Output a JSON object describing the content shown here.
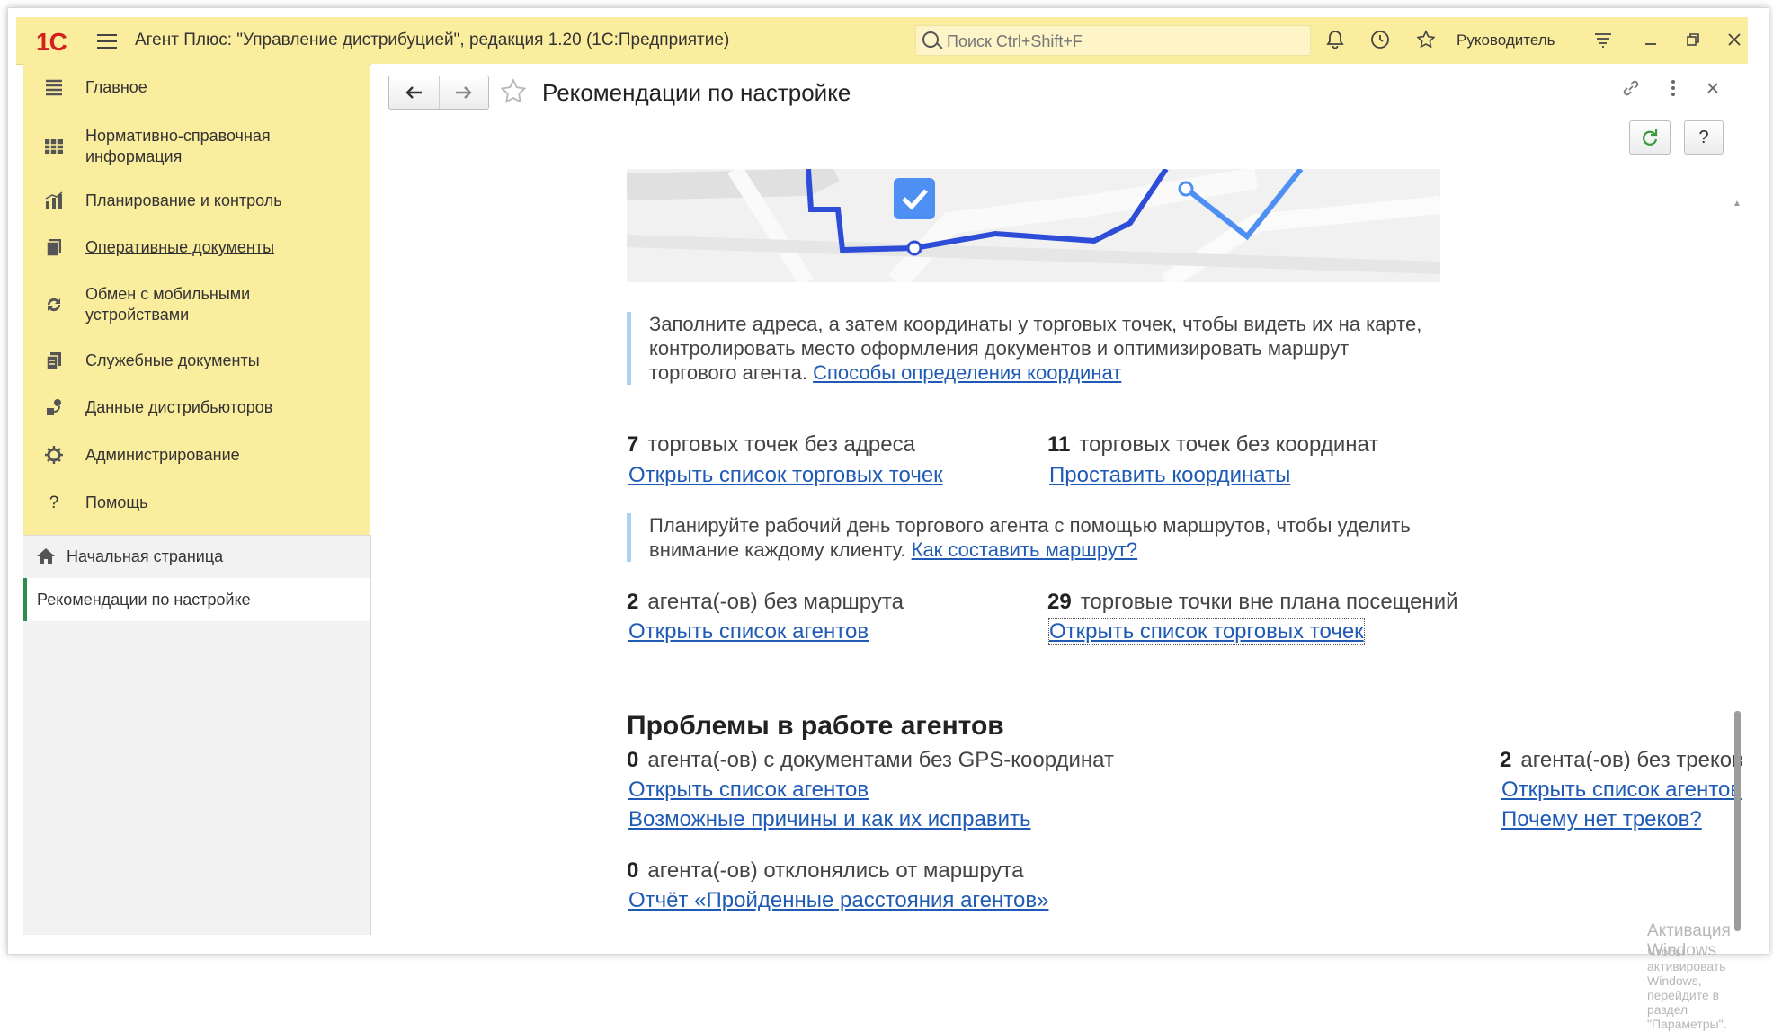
{
  "titlebar": {
    "logo": "1С",
    "app_title": "Агент Плюс: \"Управление дистрибуцией\", редакция 1.20  (1С:Предприятие)",
    "search_placeholder": "Поиск Ctrl+Shift+F",
    "role": "Руководитель",
    "icons": [
      "menu-icon",
      "search-icon",
      "bell-icon",
      "history-icon",
      "star-icon",
      "settings-icon",
      "minimize-icon",
      "restore-icon",
      "close-icon"
    ]
  },
  "sidebar": {
    "items": [
      {
        "label": "Главное",
        "icon": "menu-icon"
      },
      {
        "label": "Нормативно-справочная информация",
        "icon": "catalog-icon"
      },
      {
        "label": "Планирование и контроль",
        "icon": "chart-icon"
      },
      {
        "label": "Оперативные документы",
        "icon": "documents-icon"
      },
      {
        "label": "Обмен с мобильными устройствами",
        "icon": "sync-icon"
      },
      {
        "label": "Служебные документы",
        "icon": "service-docs-icon"
      },
      {
        "label": "Данные дистрибьюторов",
        "icon": "distributor-icon"
      },
      {
        "label": "Администрирование",
        "icon": "gear-icon"
      },
      {
        "label": "Помощь",
        "icon": "question-icon"
      }
    ],
    "home": "Начальная страница",
    "open_window": "Рекомендации по настройке"
  },
  "page": {
    "title": "Рекомендации по настройке",
    "note1_text": "Заполните адреса, а затем координаты у торговых точек, чтобы видеть их на карте, контролировать место оформления документов и оптимизировать маршрут торгового агента. ",
    "note1_link": "Способы определения координат",
    "stat1_num": "7",
    "stat1_text": "торговых точек без адреса",
    "stat1_link": "Открыть список торговых точек",
    "stat2_num": "11",
    "stat2_text": "торговых точек без координат",
    "stat2_link": "Проставить координаты",
    "note2_text": "Планируйте рабочий день торгового агента с помощью маршрутов, чтобы уделить внимание каждому клиенту. ",
    "note2_link": "Как составить маршрут?",
    "stat3_num": "2",
    "stat3_text": "агента(-ов) без маршрута",
    "stat3_link": "Открыть список агентов",
    "stat4_num": "29",
    "stat4_text": "торговые точки вне плана посещений",
    "stat4_link": "Открыть список торговых точек",
    "problems_title": "Проблемы в работе агентов",
    "stat5_num": "0",
    "stat5_text": "агента(-ов) с документами без GPS-координат",
    "stat5_link1": "Открыть список агентов",
    "stat5_link2": "Возможные причины и как их исправить",
    "stat6_num": "2",
    "stat6_text": "агента(-ов) без треков",
    "stat6_link1": "Открыть список агентов",
    "stat6_link2": "Почему нет треков?",
    "stat7_num": "0",
    "stat7_text": "агента(-ов) отклонялись от маршрута",
    "stat7_link": "Отчёт «Пройденные расстояния агентов»"
  },
  "watermark": {
    "line1": "Активация Windows",
    "line2": "Чтобы активировать Windows, перейдите в раздел \"Параметры\"."
  },
  "colors": {
    "panel": "#fbed9e",
    "link": "#1f5bb5",
    "accent_bar": "#a8d4f2",
    "brand_red": "#d3201f"
  }
}
